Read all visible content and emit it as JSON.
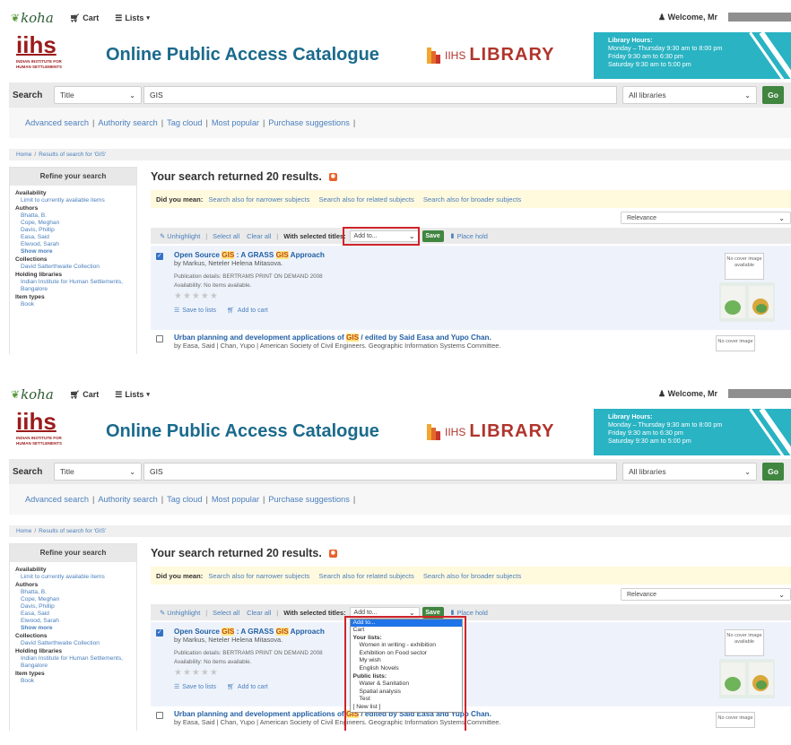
{
  "nav": {
    "brand": "koha",
    "cart": "Cart",
    "lists": "Lists",
    "welcome": "Welcome, Mr"
  },
  "header": {
    "logo_word": "iihs",
    "logo_sub": "INDIAN INSTITUTE FOR HUMAN SETTLEMENTS",
    "title": "Online Public Access Catalogue",
    "library_prefix": "IIHS",
    "library_word": "LIBRARY",
    "hours_title": "Library Hours:",
    "hours_line1": "Monday – Thursday 9:30 am to 8:00 pm",
    "hours_line2": "Friday 9:30 am to 6:30 pm",
    "hours_line3": "Saturday 9:30 am to 5:00 pm"
  },
  "search": {
    "label": "Search",
    "type": "Title",
    "query": "GIS",
    "library": "All libraries",
    "go": "Go"
  },
  "morelinks": [
    "Advanced search",
    "Authority search",
    "Tag cloud",
    "Most popular",
    "Purchase suggestions"
  ],
  "breadcrumb": {
    "home": "Home",
    "current": "Results of search for 'GIS'"
  },
  "facets": {
    "title": "Refine your search",
    "availability_head": "Availability",
    "availability_link": "Limit to currently available items",
    "authors_head": "Authors",
    "authors": [
      "Bhatta, B.",
      "Cope, Meghan",
      "Davis, Phillip",
      "Easa, Said",
      "Elwood, Sarah"
    ],
    "show_more": "Show more",
    "collections_head": "Collections",
    "collection": "David Satterthwaite Collection",
    "holding_head": "Holding libraries",
    "holding": "Indian Institute for Human Settlements, Bangalore",
    "itemtypes_head": "Item types",
    "itemtype": "Book"
  },
  "results": {
    "heading": "Your search returned 20 results.",
    "did_you_mean": "Did you mean:",
    "suggestions": [
      "Search also for narrower subjects",
      "Search also for related subjects",
      "Search also for broader subjects"
    ],
    "sort": "Relevance",
    "toolbar": {
      "unhighlight": "Unhighlight",
      "select_all": "Select all",
      "clear_all": "Clear all",
      "with_selected": "With selected titles:",
      "add_to": "Add to...",
      "save": "Save",
      "place_hold": "Place hold"
    },
    "record1": {
      "title_a": "Open Source ",
      "title_hl1": "GIS",
      "title_b": " : A GRASS ",
      "title_hl2": "GIS",
      "title_c": " Approach",
      "author": "by Markus, Neteler Helena Mitasova.",
      "publication": "Publication details: BERTRAMS PRINT ON DEMAND 2008",
      "availability": "Availability: No items available.",
      "stars": "★★★★★",
      "save_to_lists": "Save to lists",
      "add_to_cart": "Add to cart",
      "no_cover": "No cover image available"
    },
    "record2": {
      "title_a": "Urban planning and development applications of ",
      "title_hl": "GIS",
      "title_b": " / edited by Said Easa and Yupo Chan.",
      "author": "by Easa, Said | Chan, Yupo | American Society of Civil Engineers. Geographic Information Systems Committee.",
      "no_cover": "No cover image"
    }
  },
  "dropdown": {
    "selected": "Add to...",
    "cart": "Cart",
    "your_lists_head": "Your lists:",
    "your_lists": [
      "Women in writing - exhibition",
      "Exhibition on Food sector",
      "My wish",
      "English Novels"
    ],
    "public_lists_head": "Public lists:",
    "public_lists": [
      "Water & Sanitation",
      "Spatial analysis",
      "Test"
    ],
    "new_list": "[ New list ]"
  },
  "colors": {
    "accent_green": "#408540",
    "link_blue": "#4a7fbc",
    "brand_red": "#9b1b1b",
    "title_teal": "#1b6a8c",
    "hours_cyan": "#29b3c3",
    "highlight_red_box": "#d0242b"
  }
}
